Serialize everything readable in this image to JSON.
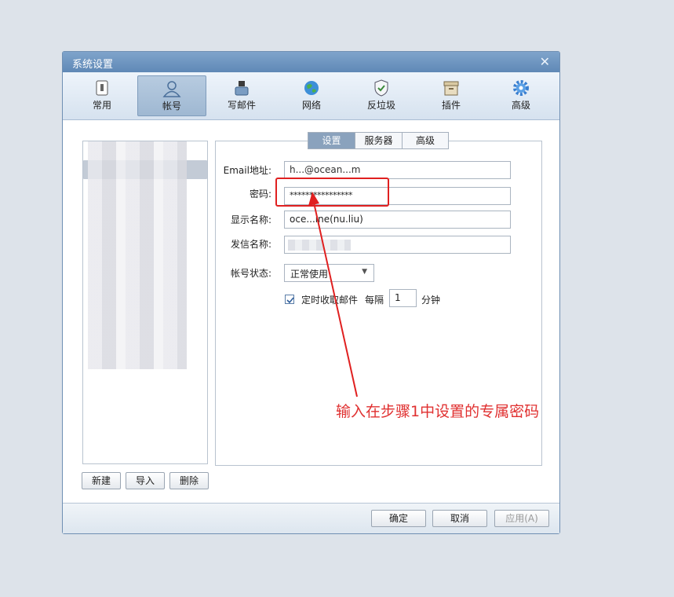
{
  "window": {
    "title": "系统设置"
  },
  "toolbar": {
    "items": [
      {
        "label": "常用",
        "icon": "switch-icon"
      },
      {
        "label": "帐号",
        "icon": "user-icon"
      },
      {
        "label": "写邮件",
        "icon": "pen-icon"
      },
      {
        "label": "网络",
        "icon": "globe-icon"
      },
      {
        "label": "反垃圾",
        "icon": "shield-icon"
      },
      {
        "label": "插件",
        "icon": "box-icon"
      },
      {
        "label": "高级",
        "icon": "gear-icon"
      }
    ],
    "active": "帐号"
  },
  "account_buttons": {
    "new": "新建",
    "import": "导入",
    "delete": "删除"
  },
  "subtabs": [
    "设置",
    "服务器",
    "高级"
  ],
  "form": {
    "email_label": "Email地址:",
    "email_value": "h...@ocean...m",
    "password_label": "密码:",
    "password_value": "****************",
    "display_name_label": "显示名称:",
    "display_name_value": "oce...ine(nu.liu)",
    "sender_name_label": "发信名称:",
    "status_label": "帐号状态:",
    "status_value": "正常使用",
    "auto_receive_label": "定时收取邮件",
    "every_label": "每隔",
    "interval_value": "1",
    "minutes_label": "分钟"
  },
  "footer": {
    "ok": "确定",
    "cancel": "取消",
    "apply": "应用(A)"
  },
  "annotation": {
    "text": "输入在步骤1中设置的专属密码",
    "color": "#e03030"
  }
}
